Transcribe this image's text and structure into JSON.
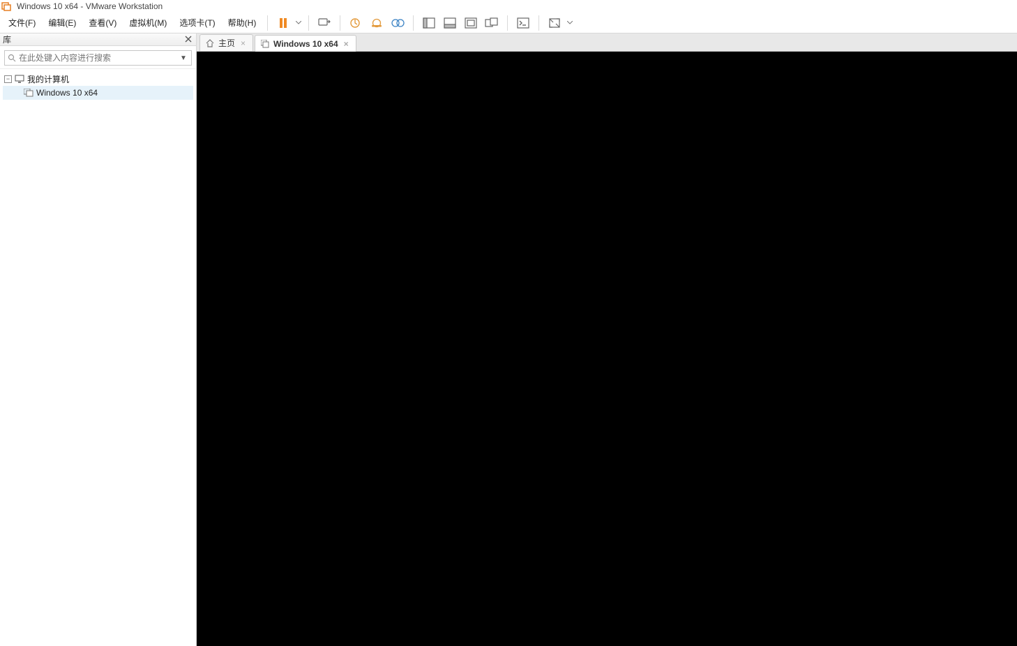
{
  "titlebar": {
    "title": "Windows 10 x64 - VMware Workstation"
  },
  "menubar": {
    "items": [
      "文件(F)",
      "编辑(E)",
      "查看(V)",
      "虚拟机(M)",
      "选项卡(T)",
      "帮助(H)"
    ]
  },
  "toolbar": {
    "icons": {
      "pause": "pause-icon",
      "power": "power-icon",
      "snapshot": "snapshot-icon",
      "revert": "revert-snapshot-icon",
      "manage_snapshot": "manage-snapshot-icon",
      "show_sidebar": "sidebar-toggle-icon",
      "show_thumbnail": "thumbnail-bar-icon",
      "single_window": "single-window-icon",
      "multi_window": "multi-window-icon",
      "unity": "quick-switch-icon",
      "fullscreen": "fullscreen-icon"
    }
  },
  "sidebar": {
    "header": "库",
    "search_placeholder": "在此处键入内容进行搜索",
    "tree": {
      "root_label": "我的计算机",
      "child_label": "Windows 10 x64"
    }
  },
  "tabs": [
    {
      "label": "主页",
      "icon": "home-icon",
      "active": false
    },
    {
      "label": "Windows 10 x64",
      "icon": "vm-icon",
      "active": true
    }
  ]
}
